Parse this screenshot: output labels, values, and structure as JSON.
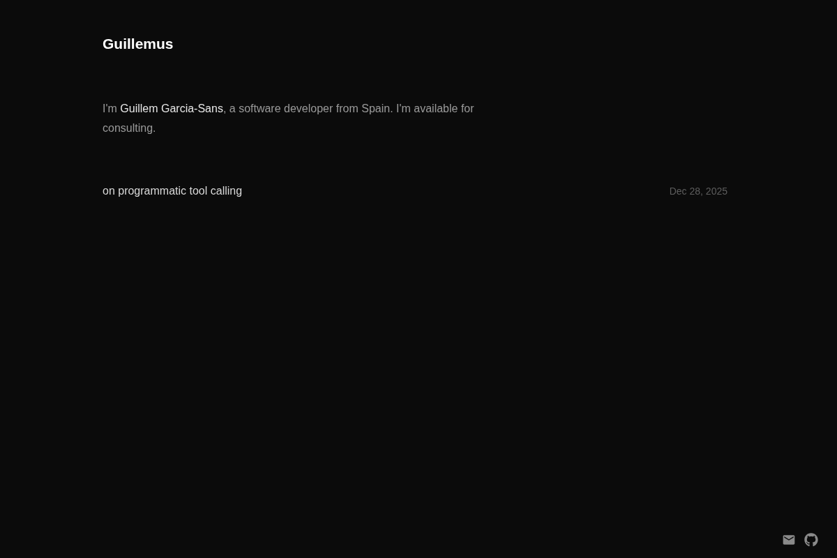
{
  "site": {
    "title": "Guillemus"
  },
  "intro": {
    "before": "I'm ",
    "link": "Guillem Garcia-Sans",
    "after": ", a software developer from Spain. I'm available for consulting."
  },
  "posts": [
    {
      "title": "on programmatic tool calling",
      "date": "Dec 28, 2025"
    }
  ]
}
